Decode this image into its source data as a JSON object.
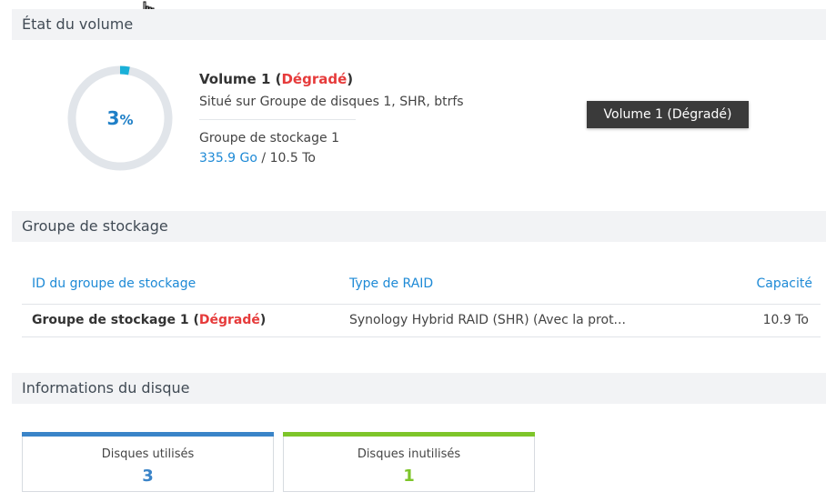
{
  "volume_state": {
    "header": "État du volume",
    "usage_percent": 3,
    "usage_percent_symbol": "%",
    "volume_name": "Volume 1",
    "status": "Dégradé",
    "location": "Situé sur Groupe de disques 1, SHR, btrfs",
    "pool_name": "Groupe de stockage 1",
    "used": "335.9 Go",
    "total": "10.5 To",
    "tooltip": "Volume 1 (Dégradé)",
    "colors": {
      "ring_track": "#e1e5ea",
      "ring_fill": "#1ab0d8",
      "percent_text": "#1e7fc7",
      "degraded": "#e63b3b"
    }
  },
  "storage_pool": {
    "header": "Groupe de stockage",
    "columns": [
      "ID du groupe de stockage",
      "Type de RAID",
      "Capacité"
    ],
    "rows": [
      {
        "id": "Groupe de stockage 1",
        "status": "Dégradé",
        "raid_type": "Synology Hybrid RAID (SHR) (Avec la prot...",
        "capacity": "10.9 To"
      }
    ]
  },
  "disk_info": {
    "header": "Informations du disque",
    "cards": [
      {
        "label": "Disques utilisés",
        "value": "3",
        "color": "#3a84c8"
      },
      {
        "label": "Disques inutilisés",
        "value": "1",
        "color": "#7ec52a"
      }
    ]
  }
}
